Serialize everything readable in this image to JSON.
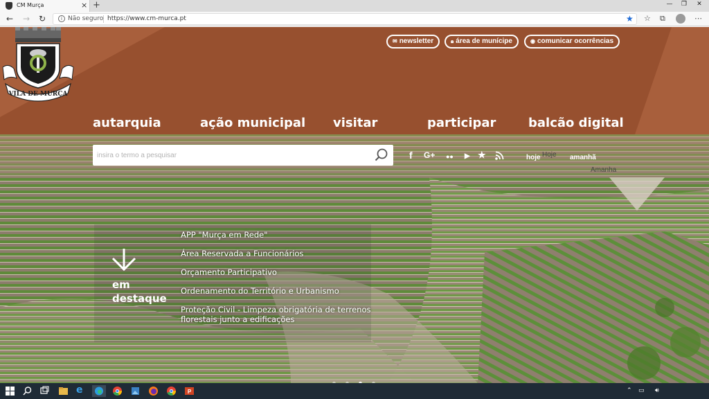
{
  "browser": {
    "tab_title": "CM Murça",
    "security_label": "Não seguro",
    "url": "https://www.cm-murca.pt"
  },
  "header": {
    "logo_text": "VILA DE MURÇA",
    "top_links": [
      {
        "label": "newsletter",
        "icon": "envelope-icon"
      },
      {
        "label": "área de munícipe",
        "icon": "lock-icon"
      },
      {
        "label": "comunicar ocorrências",
        "icon": "eye-icon"
      }
    ],
    "nav": [
      "autarquia",
      "ação municipal",
      "visitar",
      "participar",
      "balcão digital"
    ]
  },
  "search": {
    "placeholder": "insira o termo a pesquisar"
  },
  "social": [
    "facebook-icon",
    "google-plus-icon",
    "flickr-icon",
    "youtube-icon",
    "favorites-icon",
    "rss-icon"
  ],
  "weather": {
    "tabs": [
      "hoje",
      "amanhã"
    ],
    "today_label": "Hoje",
    "tomorrow_label": "Amanha"
  },
  "destaque": {
    "title": "em destaque",
    "items": [
      "APP \"Murça em Rede\"",
      "Área Reservada a Funcionários",
      "Orçamento Participativo",
      "Ordenamento do Território e Urbanismo",
      "Proteção Civil - Limpeza obrigatória de terrenos florestais junto a edificações"
    ],
    "slides": 5,
    "active_slide": 3
  },
  "colors": {
    "header": "#a85f3c",
    "header_band": "#97502f",
    "text": "#ffffff"
  }
}
